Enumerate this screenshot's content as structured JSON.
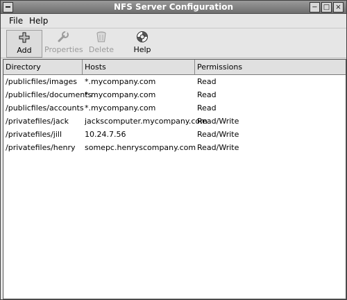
{
  "window": {
    "title": "NFS Server Configuration"
  },
  "menu": {
    "file": "File",
    "help": "Help"
  },
  "toolbar": {
    "add": "Add",
    "properties": "Properties",
    "delete": "Delete",
    "help": "Help"
  },
  "icons": {
    "add": "plus-icon",
    "properties": "wrench-icon",
    "delete": "trash-icon",
    "help": "lifebuoy-icon"
  },
  "table": {
    "columns": [
      "Directory",
      "Hosts",
      "Permissions"
    ],
    "rows": [
      [
        "/publicfiles/images",
        "*.mycompany.com",
        "Read"
      ],
      [
        "/publicfiles/documents",
        "*.mycompany.com",
        "Read"
      ],
      [
        "/publicfiles/accounts",
        "*.mycompany.com",
        "Read"
      ],
      [
        "/privatefiles/jack",
        "jackscomputer.mycompany.com",
        "Read/Write"
      ],
      [
        "/privatefiles/jill",
        "10.24.7.56",
        "Read/Write"
      ],
      [
        "/privatefiles/henry",
        "somepc.henryscompany.com",
        "Read/Write"
      ]
    ]
  }
}
